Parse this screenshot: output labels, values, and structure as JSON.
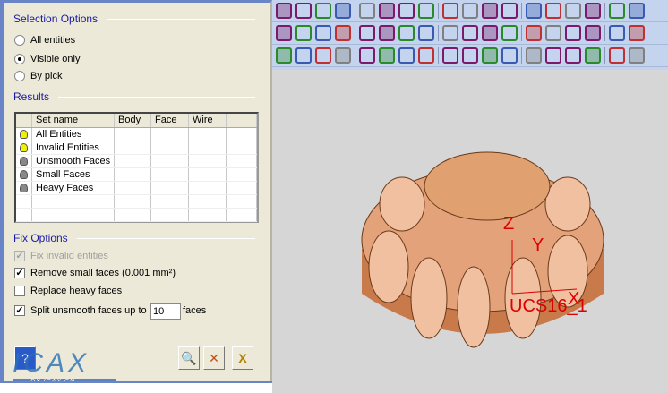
{
  "selection_options": {
    "title": "Selection Options",
    "options": [
      {
        "label": "All entities",
        "checked": false
      },
      {
        "label": "Visible only",
        "checked": true
      },
      {
        "label": "By pick",
        "checked": false
      }
    ]
  },
  "results": {
    "title": "Results",
    "columns": [
      "Set name",
      "Body",
      "Face",
      "Wire"
    ],
    "rows": [
      {
        "name": "All Entities",
        "bulb": "yellow"
      },
      {
        "name": "Invalid Entities",
        "bulb": "yellow"
      },
      {
        "name": "Unsmooth Faces",
        "bulb": "gray"
      },
      {
        "name": "Small Faces",
        "bulb": "gray"
      },
      {
        "name": "Heavy Faces",
        "bulb": "gray"
      }
    ]
  },
  "fix_options": {
    "title": "Fix Options",
    "fix_invalid": "Fix invalid entities",
    "remove_small": "Remove small faces  (0.001 mm²)",
    "replace_heavy": "Replace heavy faces",
    "split_unsmooth": "Split unsmooth faces up to",
    "split_value": "10",
    "faces_suffix": "faces"
  },
  "viewport": {
    "axis_z": "Z",
    "axis_y": "Y",
    "axis_x": "X",
    "ucs_label": "UCS16_1"
  },
  "logo": {
    "text": "ICAX",
    "subtext": "DX.ICAX.CN"
  },
  "colors": {
    "model": "#e0a070",
    "toolbar": "#c4d4ee",
    "group_title": "#1a1aa6"
  }
}
